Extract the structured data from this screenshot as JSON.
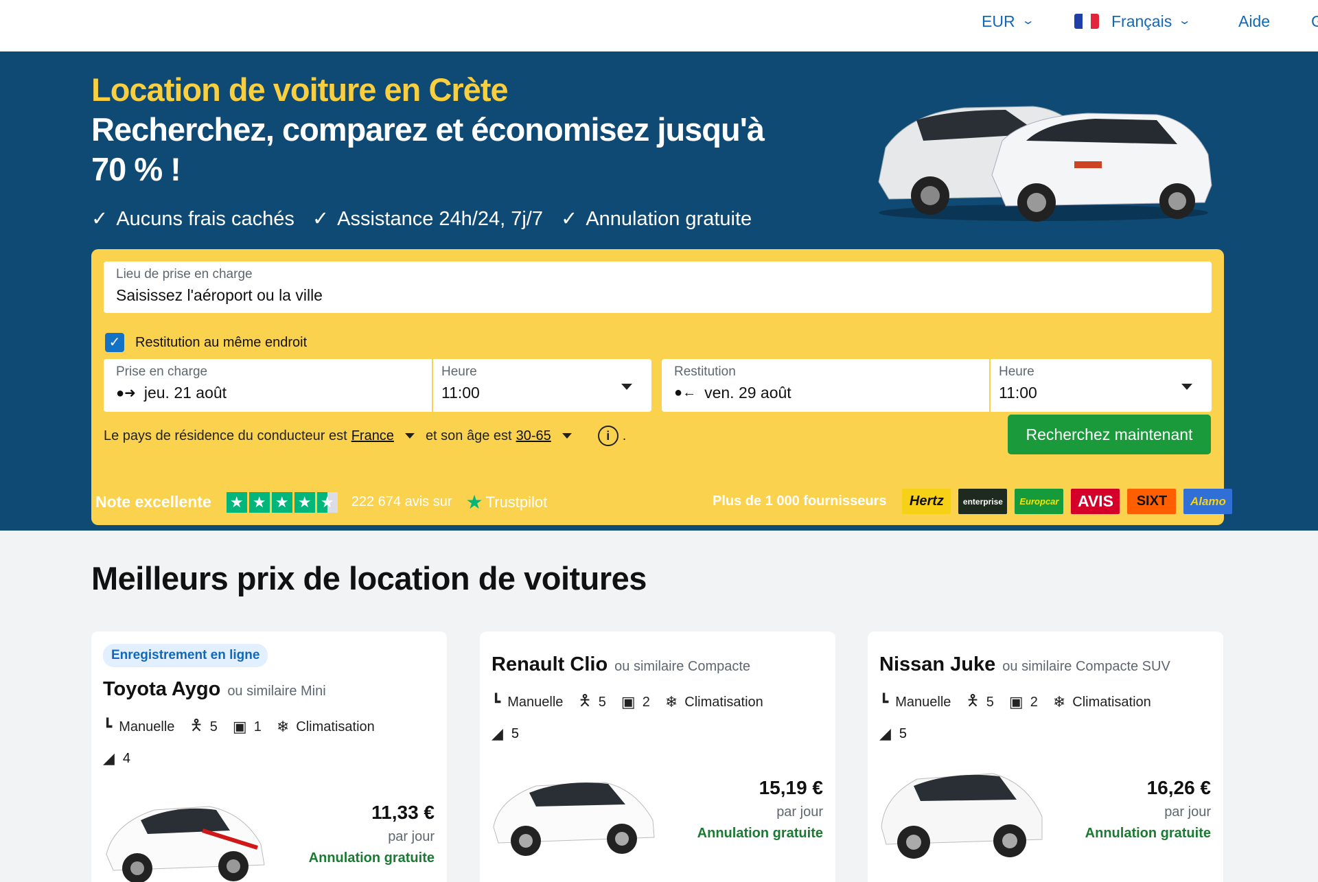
{
  "topbar": {
    "currency": "EUR",
    "language": "Français",
    "help": "Aide",
    "cut_item": "G"
  },
  "hero": {
    "title": "Location de voiture en Crète",
    "subtitle": "Recherchez, comparez et économisez jusqu'à 70 % !",
    "bullets": [
      "Aucuns frais cachés",
      "Assistance 24h/24, 7j/7",
      "Annulation gratuite"
    ]
  },
  "search": {
    "pickup_location_label": "Lieu de prise en charge",
    "pickup_location_placeholder": "Saisissez l'aéroport ou la ville",
    "same_location_label": "Restitution au même endroit",
    "pickup_label": "Prise en charge",
    "pickup_date": "jeu. 21 août",
    "pickup_time_label": "Heure",
    "pickup_time": "11:00",
    "return_label": "Restitution",
    "return_date": "ven. 29 août",
    "return_time_label": "Heure",
    "return_time": "11:00",
    "residence_prefix": "Le pays de résidence du conducteur est",
    "residence_country": "France",
    "age_prefix": "et son âge est",
    "age_range": "30-65",
    "info_icon_text": "i",
    "trailing_dot": ".",
    "search_button": "Recherchez maintenant"
  },
  "rating": {
    "label": "Note excellente",
    "review_count": "222 674 avis sur",
    "trustpilot": "Trustpilot",
    "stars": 4.5
  },
  "suppliers": {
    "label": "Plus de 1 000 fournisseurs",
    "logos": [
      {
        "name": "Hertz",
        "bg": "#f7d117",
        "fg": "#111"
      },
      {
        "name": "enterprise",
        "bg": "#1d2a1d",
        "fg": "#fff"
      },
      {
        "name": "Europcar",
        "bg": "#169b3c",
        "fg": "#f7e400"
      },
      {
        "name": "AVIS",
        "bg": "#d4002a",
        "fg": "#fff"
      },
      {
        "name": "SIXT",
        "bg": "#ff5f00",
        "fg": "#111"
      },
      {
        "name": "Alamo",
        "bg": "#2f6fd6",
        "fg": "#f7d117"
      }
    ]
  },
  "section_title": "Meilleurs prix de location de voitures",
  "cards": [
    {
      "badge": "Enregistrement en ligne",
      "name": "Toyota Aygo",
      "similar": "ou similaire Mini",
      "transmission": "Manuelle",
      "seats": "5",
      "bags": "1",
      "ac": "Climatisation",
      "doors": "4",
      "price": "11,33 €",
      "per_day": "par jour",
      "cancellation": "Annulation gratuite",
      "car_color": "#ffffff",
      "accent": "#d01818"
    },
    {
      "name": "Renault Clio",
      "similar": "ou similaire Compacte",
      "transmission": "Manuelle",
      "seats": "5",
      "bags": "2",
      "ac": "Climatisation",
      "doors": "5",
      "price": "15,19 €",
      "per_day": "par jour",
      "cancellation": "Annulation gratuite",
      "car_color": "#ffffff",
      "accent": "#333333"
    },
    {
      "name": "Nissan Juke",
      "similar": "ou similaire Compacte SUV",
      "transmission": "Manuelle",
      "seats": "5",
      "bags": "2",
      "ac": "Climatisation",
      "doors": "5",
      "price": "16,26 €",
      "per_day": "par jour",
      "cancellation": "Annulation gratuite",
      "car_color": "#ffffff",
      "accent": "#222222"
    }
  ],
  "colors": {
    "hero_bg": "#0f4a74",
    "accent_yellow": "#fbd24e",
    "title_yellow": "#f9cf3f",
    "link_blue": "#1268b8",
    "button_green": "#1b9a3b",
    "trust_green": "#00b67a"
  }
}
